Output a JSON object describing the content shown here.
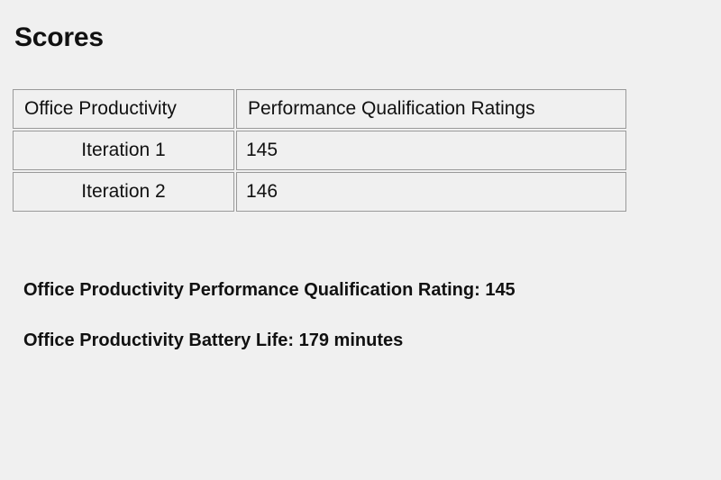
{
  "page": {
    "title": "Scores",
    "background_color": "#f0f0f0",
    "text_color": "#111111",
    "border_color": "#9a9a9a"
  },
  "table": {
    "headers": {
      "label": "Office Productivity",
      "value": "Performance Qualification Ratings"
    },
    "rows": [
      {
        "label": "Iteration 1",
        "value": "145"
      },
      {
        "label": "Iteration 2",
        "value": "146"
      }
    ]
  },
  "summary": {
    "rating_line": "Office Productivity Performance Qualification Rating: 145",
    "battery_line": "Office Productivity Battery Life: 179 minutes"
  },
  "chart_data": {
    "type": "table",
    "title": "Scores",
    "categories": [
      "Iteration 1",
      "Iteration 2"
    ],
    "series": [
      {
        "name": "Performance Qualification Ratings",
        "values": [
          145,
          146
        ]
      }
    ],
    "annotations": [
      "Office Productivity Performance Qualification Rating: 145",
      "Office Productivity Battery Life: 179 minutes"
    ],
    "xlabel": "Office Productivity",
    "ylabel": "Performance Qualification Ratings"
  }
}
